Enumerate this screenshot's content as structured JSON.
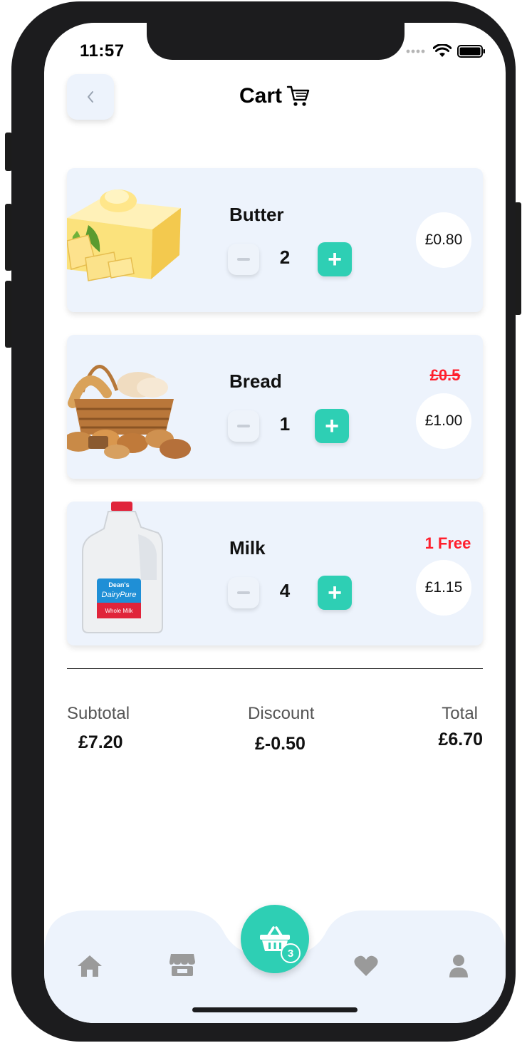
{
  "status": {
    "time": "11:57"
  },
  "header": {
    "title": "Cart",
    "back_icon": "chevron-left-icon",
    "cart_icon": "cart-icon"
  },
  "items": [
    {
      "name": "Butter",
      "qty": "2",
      "price": "£0.80",
      "old_price": "",
      "tag": ""
    },
    {
      "name": "Bread",
      "qty": "1",
      "price": "£1.00",
      "old_price": "£0.5",
      "tag": ""
    },
    {
      "name": "Milk",
      "qty": "4",
      "price": "£1.15",
      "old_price": "",
      "tag": "1 Free"
    }
  ],
  "summary": {
    "subtotal_label": "Subtotal",
    "subtotal_value": "£7.20",
    "discount_label": "Discount",
    "discount_value": "£-0.50",
    "total_label": "Total",
    "total_value": "£6.70"
  },
  "milk_label": {
    "brand": "Dean's",
    "product": "DairyPure",
    "variant": "Whole Milk"
  },
  "nav": {
    "basket_count": "3",
    "active": "basket"
  },
  "colors": {
    "accent": "#2ecfb4",
    "card_bg": "#edf3fc",
    "alert": "#ff1f2d"
  }
}
